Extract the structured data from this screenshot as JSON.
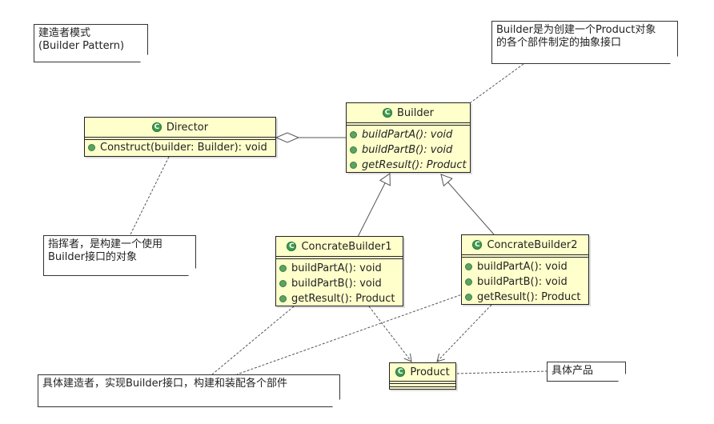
{
  "diagram": {
    "type": "UML class diagram",
    "colors": {
      "class_fill": "#ffffcc",
      "class_icon": "#3f9a4f",
      "operation_dot": "#5aa363",
      "line": "#555555"
    },
    "notes": [
      {
        "id": "title",
        "lines": [
          "建造者模式",
          "(Builder Pattern)"
        ]
      },
      {
        "id": "builder-note",
        "lines": [
          "Builder是为创建一个Product对象",
          "的各个部件制定的抽象接口"
        ]
      },
      {
        "id": "director-note",
        "lines": [
          "指挥者，是构建一个使用",
          "Builder接口的对象"
        ]
      },
      {
        "id": "concrete-note",
        "lines": [
          "具体建造者，实现Builder接口，构建和装配各个部件"
        ]
      },
      {
        "id": "product-note",
        "lines": [
          "具体产品"
        ]
      }
    ],
    "classes": {
      "director": {
        "name": "Director",
        "icon": "class-icon",
        "operations": [
          "Construct(builder: Builder): void"
        ]
      },
      "builder": {
        "name": "Builder",
        "icon": "class-icon",
        "abstract_ops": true,
        "operations": [
          "buildPartA(): void",
          "buildPartB(): void",
          "getResult(): Product"
        ]
      },
      "concrete1": {
        "name": "ConcrateBuilder1",
        "icon": "class-icon",
        "operations": [
          "buildPartA(): void",
          "buildPartB(): void",
          "getResult(): Product"
        ]
      },
      "concrete2": {
        "name": "ConcrateBuilder2",
        "icon": "class-icon",
        "operations": [
          "buildPartA(): void",
          "buildPartB(): void",
          "getResult(): Product"
        ]
      },
      "product": {
        "name": "Product",
        "icon": "class-icon",
        "operations": []
      }
    },
    "relations": [
      {
        "type": "aggregation",
        "from": "Director",
        "to": "Builder"
      },
      {
        "type": "generalization",
        "from": "ConcrateBuilder1",
        "to": "Builder"
      },
      {
        "type": "generalization",
        "from": "ConcrateBuilder2",
        "to": "Builder"
      },
      {
        "type": "dependency",
        "from": "ConcrateBuilder1",
        "to": "Product"
      },
      {
        "type": "dependency",
        "from": "ConcrateBuilder2",
        "to": "Product"
      },
      {
        "type": "note-link",
        "from": "builder-note",
        "to": "Builder"
      },
      {
        "type": "note-link",
        "from": "director-note",
        "to": "Director"
      },
      {
        "type": "note-link",
        "from": "concrete-note",
        "to": "ConcrateBuilder1"
      },
      {
        "type": "note-link",
        "from": "concrete-note",
        "to": "ConcrateBuilder2"
      },
      {
        "type": "note-link",
        "from": "product-note",
        "to": "Product"
      }
    ]
  }
}
